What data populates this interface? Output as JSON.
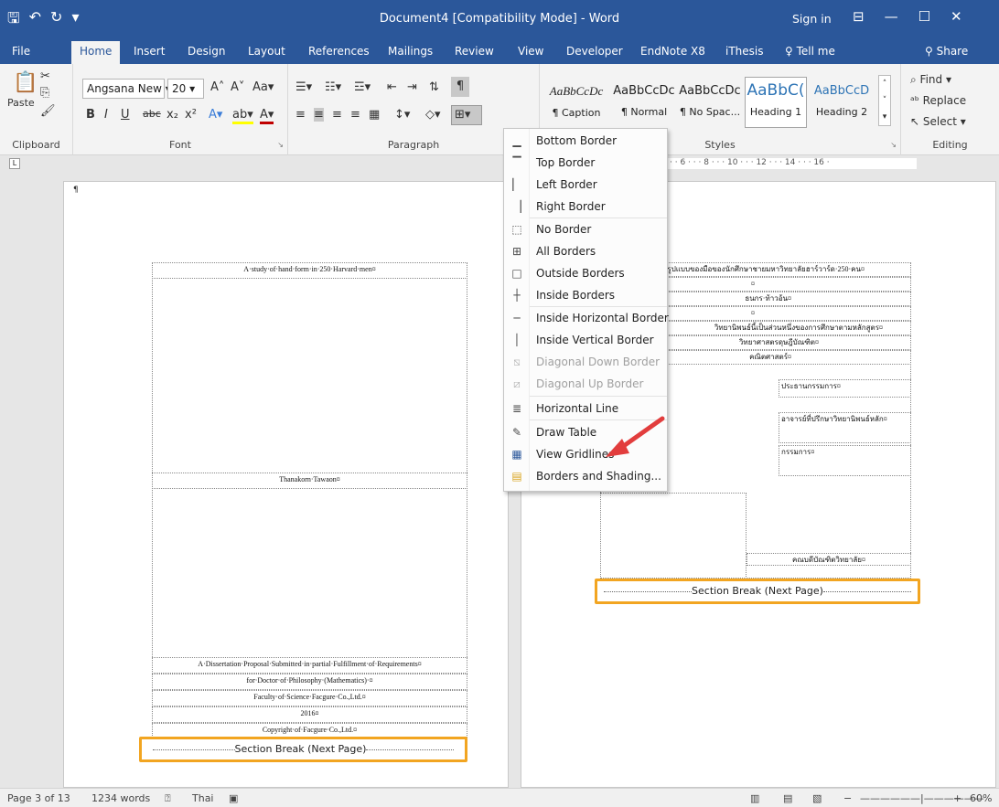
{
  "app": {
    "title": "Document4 [Compatibility Mode] - Word",
    "sign_in": "Sign in",
    "qat": {
      "save_icon": "save-icon",
      "undo_icon": "undo-icon",
      "redo_icon": "redo-icon"
    }
  },
  "tabs": [
    "File",
    "Home",
    "Insert",
    "Design",
    "Layout",
    "References",
    "Mailings",
    "Review",
    "View",
    "Developer",
    "EndNote X8",
    "iThesis",
    "Tell me"
  ],
  "share": "Share",
  "ribbon": {
    "clipboard": {
      "label": "Clipboard",
      "paste": "Paste"
    },
    "font": {
      "label": "Font",
      "family": "Angsana New",
      "size": "20"
    },
    "paragraph": {
      "label": "Paragraph"
    },
    "styles": {
      "label": "Styles",
      "items": [
        {
          "preview": "AaBbCcDc",
          "name": "¶ Caption"
        },
        {
          "preview": "AaBbCcDc",
          "name": "¶ Normal"
        },
        {
          "preview": "AaBbCcDc",
          "name": "¶ No Spac..."
        },
        {
          "preview": "AaBbC(",
          "name": "Heading 1"
        },
        {
          "preview": "AaBbCcD",
          "name": "Heading 2"
        }
      ]
    },
    "editing": {
      "label": "Editing",
      "find": "Find",
      "replace": "Replace",
      "select": "Select"
    }
  },
  "ruler": {
    "text": "· 4 · · · 6 · · · 8 · · · 10 · · · 12 · · · 14 · · · 16 ·"
  },
  "page1": {
    "title": "A·study·of·hand·form·in·250·Harvard·men¤",
    "author": "Thanakorn·Tawaon¤",
    "proposal": "A·Dissertation·Proposal·Submitted·in·partial·Fulfillment·of·Requirements¤",
    "degree": "for·Doctor·of·Philosophy·(Mathematics)·¤",
    "faculty": "Faculty·of·Science·Facgure·Co.,Ltd.¤",
    "year": "2016¤",
    "copyright": "Copyright·of·Facgure·Co.,Ltd.¤",
    "section_break": "Section Break (Next Page)"
  },
  "page2": {
    "rows": [
      "ลักษณะรูปแบบของมือของนักศึกษาชายมหาวิทยาลัยฮาร์วาร์ด·250·คน¤",
      "¤",
      "ธนกร·ท้าวอ้น¤",
      "¤",
      "วิทยานิพนธ์นี้เป็นส่วนหนึ่งของการศึกษาตามหลักสูตร¤",
      "วิทยาศาสตรดุษฎีบัณฑิต¤",
      "คณิตศาสตร์¤"
    ],
    "chair": "ประธานกรรมการ¤",
    "advisor": "อาจารย์ที่ปรึกษาวิทยานิพนธ์หลัก¤",
    "committee": "กรรมการ¤",
    "date_note": "คณบดีบัณฑิตวิทยาลัย¤",
    "section_break": "Section Break (Next Page)"
  },
  "border_menu": {
    "items": [
      {
        "label": "Bottom Border",
        "icon": "bottom-border-icon",
        "disabled": false
      },
      {
        "label": "Top Border",
        "icon": "top-border-icon",
        "disabled": false
      },
      {
        "label": "Left Border",
        "icon": "left-border-icon",
        "disabled": false
      },
      {
        "label": "Right Border",
        "icon": "right-border-icon",
        "disabled": false
      },
      {
        "label": "No Border",
        "icon": "no-border-icon",
        "disabled": false
      },
      {
        "label": "All Borders",
        "icon": "all-borders-icon",
        "disabled": false
      },
      {
        "label": "Outside Borders",
        "icon": "outside-borders-icon",
        "disabled": false
      },
      {
        "label": "Inside Borders",
        "icon": "inside-borders-icon",
        "disabled": false
      },
      {
        "label": "Inside Horizontal Border",
        "icon": "inside-horizontal-border-icon",
        "disabled": false
      },
      {
        "label": "Inside Vertical Border",
        "icon": "inside-vertical-border-icon",
        "disabled": false
      },
      {
        "label": "Diagonal Down Border",
        "icon": "diagonal-down-border-icon",
        "disabled": true
      },
      {
        "label": "Diagonal Up Border",
        "icon": "diagonal-up-border-icon",
        "disabled": true
      },
      {
        "label": "Horizontal Line",
        "icon": "horizontal-line-icon",
        "disabled": false
      },
      {
        "label": "Draw Table",
        "icon": "draw-table-icon",
        "disabled": false
      },
      {
        "label": "View Gridlines",
        "icon": "view-gridlines-icon",
        "disabled": false
      },
      {
        "label": "Borders and Shading...",
        "icon": "borders-and-shading-icon",
        "disabled": false
      }
    ]
  },
  "status": {
    "page": "Page 3 of 13",
    "words": "1234 words",
    "language": "Thai",
    "zoom": "60%"
  },
  "colors": {
    "accent": "#2b579a",
    "highlight": "#f2a521",
    "arrow": "#e23d3d"
  }
}
